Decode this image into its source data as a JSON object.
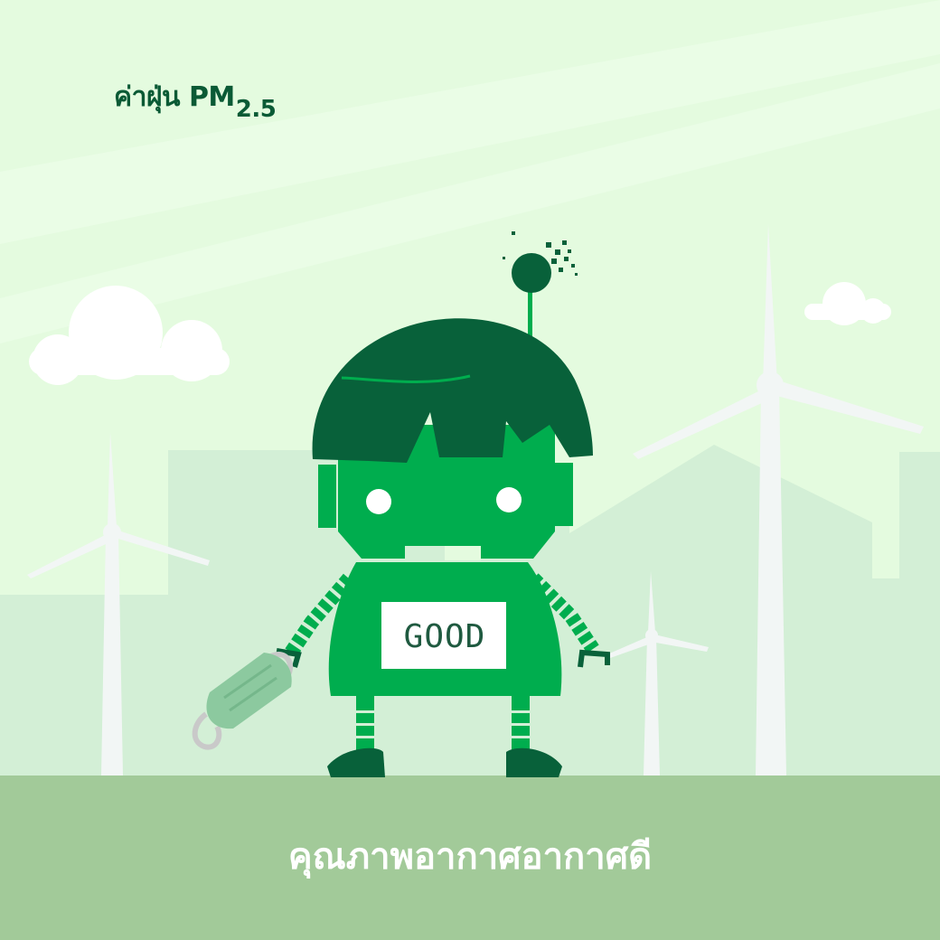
{
  "header": {
    "title_main": "ค่าฝุ่น PM",
    "title_sub": "2.5"
  },
  "robot": {
    "badge_label": "GOOD"
  },
  "footer": {
    "status_text": "คุณภาพอากาศอากาศดี"
  },
  "colors": {
    "sky": "#e4fbdf",
    "ground": "#a2ca99",
    "city": "#d3efd6",
    "robot_body": "#00ad4e",
    "robot_hair": "#08613a",
    "turbine": "#f2f6f5",
    "mask": "#8cc99f"
  }
}
